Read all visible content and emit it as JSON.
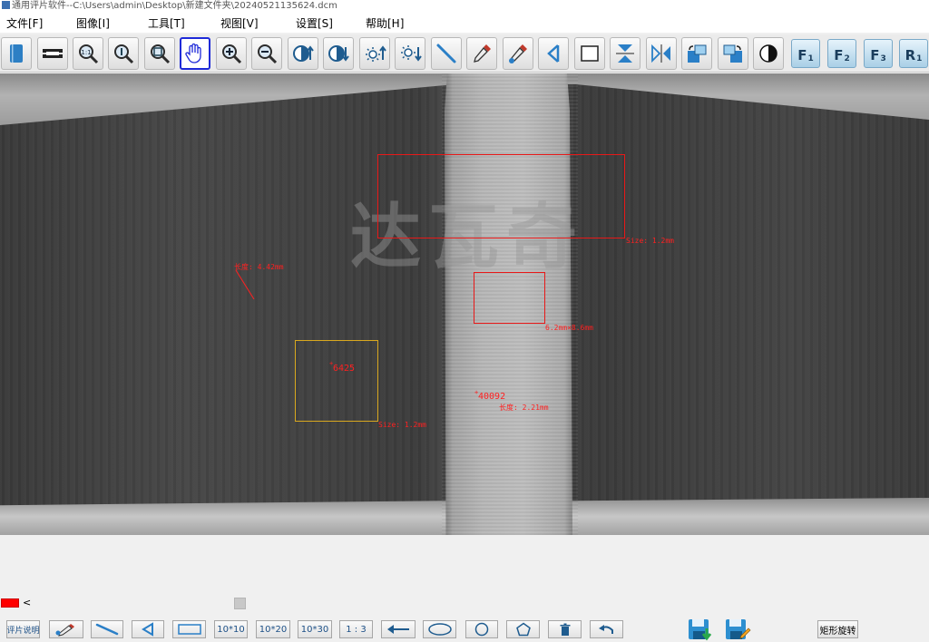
{
  "window": {
    "title": "通用评片软件--C:\\Users\\admin\\Desktop\\新建文件夹\\20240521135624.dcm"
  },
  "menu": [
    {
      "label": "文件[F]"
    },
    {
      "label": "图像[I]"
    },
    {
      "label": "工具[T]"
    },
    {
      "label": "视图[V]"
    },
    {
      "label": "设置[S]"
    },
    {
      "label": "帮助[H]"
    }
  ],
  "toolbar": {
    "icons": [
      "book-icon",
      "level-icon",
      "zoom-fit-icon",
      "zoom-info-icon",
      "zoom-full-icon",
      "hand-pan-icon",
      "zoom-in-icon",
      "zoom-out-icon",
      "contrast-up-icon",
      "contrast-down-icon",
      "brightness-up-icon",
      "brightness-down-icon",
      "line-tool-icon",
      "eyedropper-icon",
      "eyedropper-plus-icon",
      "triangle-icon",
      "rectangle-icon",
      "flip-vertical-icon",
      "flip-horizontal-icon",
      "rotate-left-icon",
      "rotate-right-icon",
      "invert-icon"
    ],
    "active_tool": "hand-pan-icon",
    "function_keys": [
      {
        "letter": "F",
        "sub": "1"
      },
      {
        "letter": "F",
        "sub": "2"
      },
      {
        "letter": "F",
        "sub": "3"
      },
      {
        "letter": "R",
        "sub": "1"
      }
    ]
  },
  "viewer": {
    "watermark": "达瓦奇",
    "annotations": {
      "rect1_size": "Size: 1.2mm",
      "rect2_size": "6.2mm×8.6mm",
      "rect3_size": "Size: 1.2mm",
      "left_length": "长度: 4.42mm",
      "point1_value": "6425",
      "point2_value": "40092",
      "right_length": "长度: 2.21mm"
    },
    "colors": {
      "annotation": "#ff2020",
      "yellow_box": "#d9a81f"
    }
  },
  "footer": {
    "annotation_color": "#ff0000",
    "collapse_glyph": "<"
  },
  "bottom_tools": {
    "description_label": "评片说明",
    "grid_10x10": "10*10",
    "grid_10x20": "10*20",
    "grid_10x30": "10*30",
    "ratio_1_3": "1 : 3",
    "rect_rotate_label": "矩形旋转",
    "icons": [
      "eyedropper-icon",
      "line-tool-icon",
      "triangle-icon",
      "rectangle-icon",
      "arrow-left-icon",
      "ellipse-icon",
      "circle-icon",
      "pentagon-icon",
      "trash-icon",
      "undo-icon",
      "save-download-icon",
      "save-edit-icon"
    ]
  }
}
